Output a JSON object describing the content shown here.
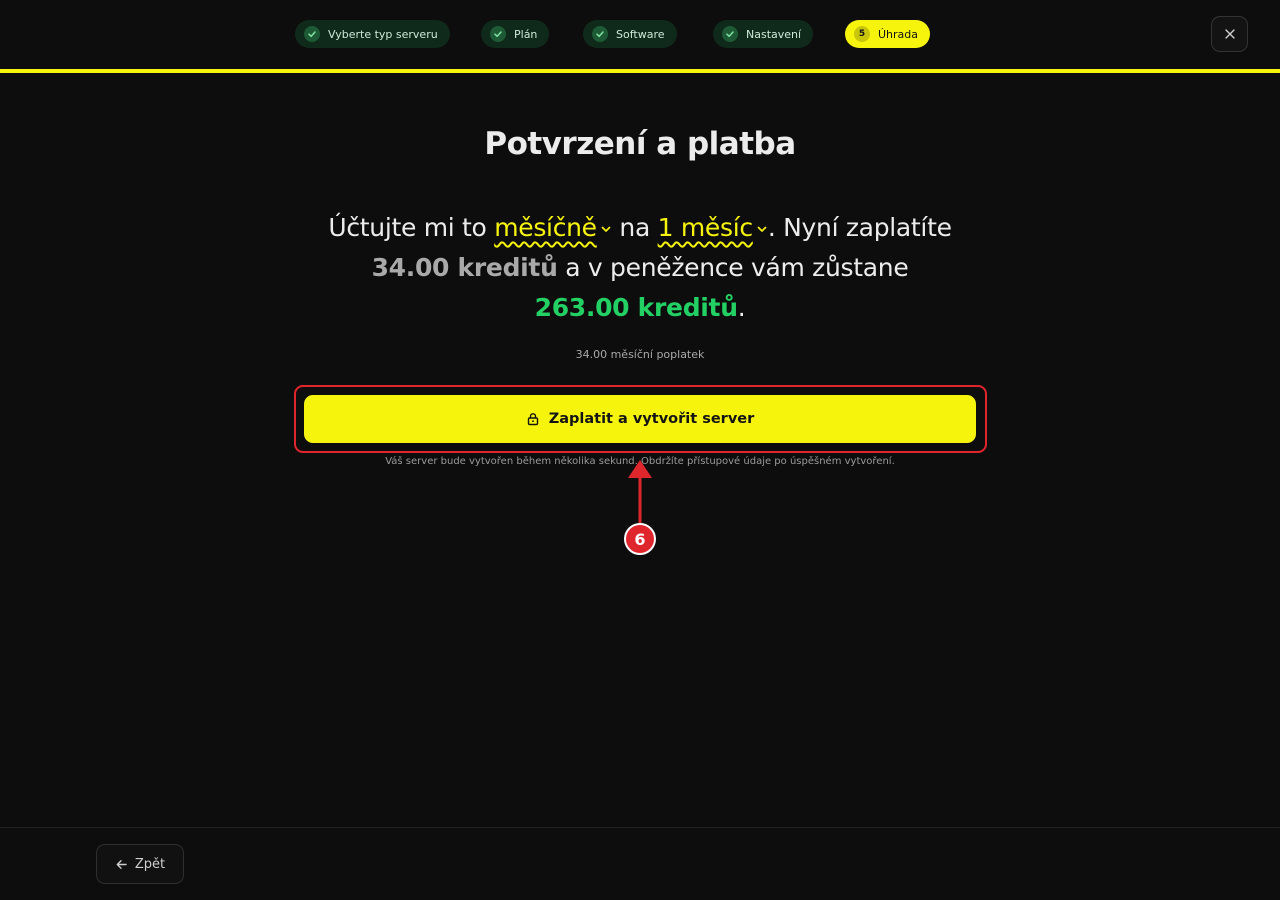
{
  "stepper": {
    "steps": [
      {
        "label": "Vyberte typ serveru",
        "status": "done"
      },
      {
        "label": "Plán",
        "status": "done"
      },
      {
        "label": "Software",
        "status": "done"
      },
      {
        "label": "Nastavení",
        "status": "done"
      },
      {
        "label": "Úhrada",
        "status": "active",
        "number": "5"
      }
    ],
    "close_icon": "close-icon"
  },
  "main": {
    "title": "Potvrzení a platba",
    "sentence": {
      "part1": "Účtujte mi to ",
      "billing_cycle": "měsíčně",
      "part2": " na ",
      "period": "1 měsíc",
      "part3": ". Nyní zaplatíte",
      "pay_amount": "34.00 kreditů",
      "part4": " a v peněžence vám zůstane",
      "remaining_amount": "263.00 kreditů",
      "part5": "."
    },
    "fee_note": "34.00 měsíční poplatek",
    "pay_button": "Zaplatit a vytvořit server",
    "info_note": "Váš server bude vytvořen během několika sekund. Obdržíte přístupové údaje po úspěšném vytvoření."
  },
  "annotation": {
    "badge": "6"
  },
  "footer": {
    "back_button": "Zpět"
  },
  "colors": {
    "accent": "#f6f40d",
    "success": "#22d063",
    "background": "#0e0d0d",
    "annotation": "#e0262d"
  }
}
